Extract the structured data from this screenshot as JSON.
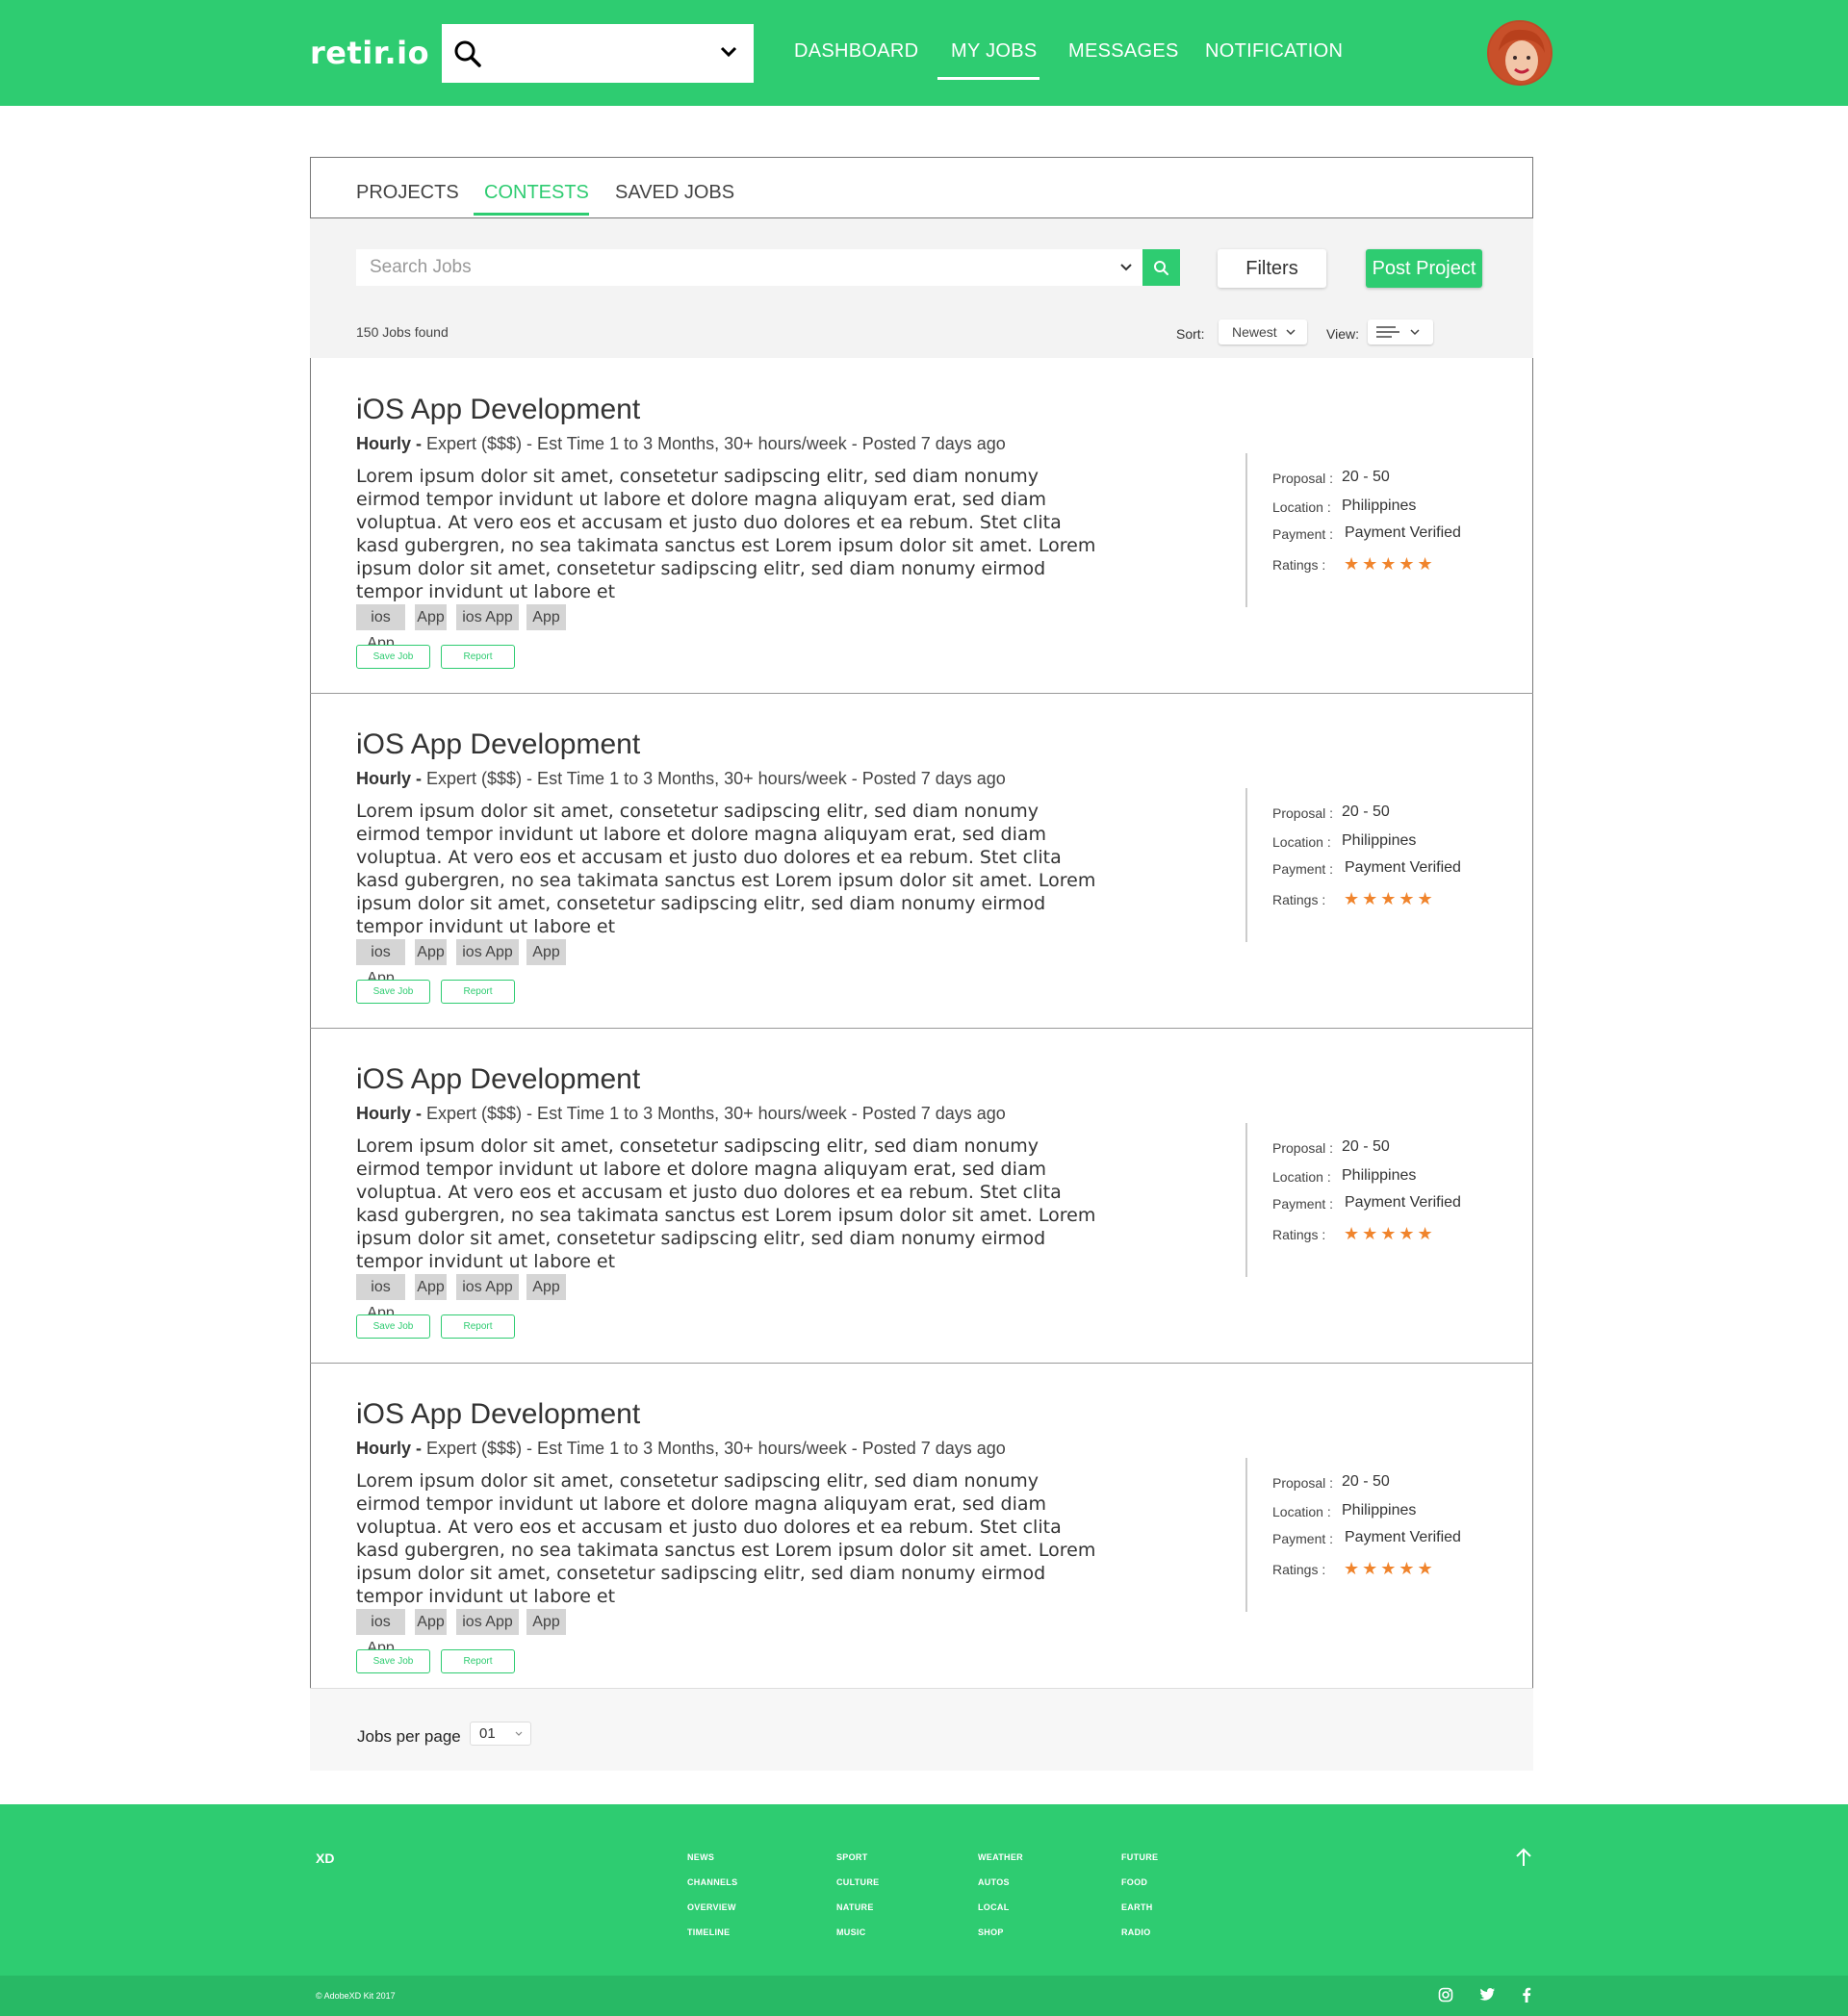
{
  "header": {
    "logo": "retir.io",
    "search_value": "",
    "nav": [
      "DASHBOARD",
      "MY JOBS",
      "MESSAGES",
      "NOTIFICATION"
    ],
    "active_nav": "MY JOBS"
  },
  "tabs": [
    "PROJECTS",
    "CONTESTS",
    "SAVED JOBS"
  ],
  "active_tab": "CONTESTS",
  "toolbar": {
    "search_placeholder": "Search Jobs",
    "filters_label": "Filters",
    "post_label": "Post Project",
    "jobs_found": "150 Jobs found",
    "sort_label": "Sort:",
    "sort_value": "Newest",
    "view_label": "View:"
  },
  "jobs": [
    {
      "title": "iOS App Development",
      "type": "Hourly -",
      "meta": " Expert ($$$) - Est Time  1 to 3 Months, 30+ hours/week - Posted 7 days ago",
      "description": "Lorem ipsum dolor sit amet, consetetur sadipscing elitr, sed diam nonumy eirmod tempor invidunt ut labore et dolore magna aliquyam erat, sed diam voluptua. At vero eos et accusam et justo duo dolores et ea rebum. Stet clita kasd gubergren, no sea takimata sanctus est Lorem ipsum dolor sit amet. Lorem ipsum dolor sit amet, consetetur sadipscing elitr, sed diam nonumy eirmod tempor invidunt ut labore et",
      "tags": [
        "ios App",
        "App",
        "ios App",
        "App"
      ],
      "save_label": "Save Job",
      "report_label": "Report",
      "proposal_label": "Proposal :",
      "proposal": "20 - 50",
      "location_label": "Location :",
      "location": "Philippines",
      "payment_label": "Payment :",
      "payment": "Payment Verified",
      "ratings_label": "Ratings :",
      "rating": 5,
      "stars": "★★★★★"
    },
    {
      "title": "iOS App Development",
      "type": "Hourly -",
      "meta": " Expert ($$$) - Est Time  1 to 3 Months, 30+ hours/week - Posted 7 days ago",
      "description": "Lorem ipsum dolor sit amet, consetetur sadipscing elitr, sed diam nonumy eirmod tempor invidunt ut labore et dolore magna aliquyam erat, sed diam voluptua. At vero eos et accusam et justo duo dolores et ea rebum. Stet clita kasd gubergren, no sea takimata sanctus est Lorem ipsum dolor sit amet. Lorem ipsum dolor sit amet, consetetur sadipscing elitr, sed diam nonumy eirmod tempor invidunt ut labore et",
      "tags": [
        "ios App",
        "App",
        "ios App",
        "App"
      ],
      "save_label": "Save Job",
      "report_label": "Report",
      "proposal_label": "Proposal :",
      "proposal": "20 - 50",
      "location_label": "Location :",
      "location": "Philippines",
      "payment_label": "Payment :",
      "payment": "Payment Verified",
      "ratings_label": "Ratings :",
      "rating": 5,
      "stars": "★★★★★"
    },
    {
      "title": "iOS App Development",
      "type": "Hourly -",
      "meta": " Expert ($$$) - Est Time  1 to 3 Months, 30+ hours/week - Posted 7 days ago",
      "description": "Lorem ipsum dolor sit amet, consetetur sadipscing elitr, sed diam nonumy eirmod tempor invidunt ut labore et dolore magna aliquyam erat, sed diam voluptua. At vero eos et accusam et justo duo dolores et ea rebum. Stet clita kasd gubergren, no sea takimata sanctus est Lorem ipsum dolor sit amet. Lorem ipsum dolor sit amet, consetetur sadipscing elitr, sed diam nonumy eirmod tempor invidunt ut labore et",
      "tags": [
        "ios App",
        "App",
        "ios App",
        "App"
      ],
      "save_label": "Save Job",
      "report_label": "Report",
      "proposal_label": "Proposal :",
      "proposal": "20 - 50",
      "location_label": "Location :",
      "location": "Philippines",
      "payment_label": "Payment :",
      "payment": "Payment Verified",
      "ratings_label": "Ratings :",
      "rating": 5,
      "stars": "★★★★★"
    },
    {
      "title": "iOS App Development",
      "type": "Hourly -",
      "meta": " Expert ($$$) - Est Time  1 to 3 Months, 30+ hours/week - Posted 7 days ago",
      "description": "Lorem ipsum dolor sit amet, consetetur sadipscing elitr, sed diam nonumy eirmod tempor invidunt ut labore et dolore magna aliquyam erat, sed diam voluptua. At vero eos et accusam et justo duo dolores et ea rebum. Stet clita kasd gubergren, no sea takimata sanctus est Lorem ipsum dolor sit amet. Lorem ipsum dolor sit amet, consetetur sadipscing elitr, sed diam nonumy eirmod tempor invidunt ut labore et",
      "tags": [
        "ios App",
        "App",
        "ios App",
        "App"
      ],
      "save_label": "Save Job",
      "report_label": "Report",
      "proposal_label": "Proposal :",
      "proposal": "20 - 50",
      "location_label": "Location :",
      "location": "Philippines",
      "payment_label": "Payment :",
      "payment": "Payment Verified",
      "ratings_label": "Ratings :",
      "rating": 5,
      "stars": "★★★★★"
    }
  ],
  "pager": {
    "label": "Jobs per page",
    "value": "01"
  },
  "footer": {
    "logo": "XD",
    "columns": [
      [
        "NEWS",
        "CHANNELS",
        "OVERVIEW",
        "TIMELINE"
      ],
      [
        "SPORT",
        "CULTURE",
        "NATURE",
        "MUSIC"
      ],
      [
        "WEATHER",
        "AUTOS",
        "LOCAL",
        "SHOP"
      ],
      [
        "FUTURE",
        "FOOD",
        "EARTH",
        "RADIO"
      ]
    ],
    "copyright": "© AdobeXD Kit 2017",
    "social": [
      "instagram-icon",
      "twitter-icon",
      "facebook-icon"
    ]
  },
  "colors": {
    "brand": "#2ecc71",
    "star": "#f0842c",
    "toolbar_bg": "#f3f3f3"
  }
}
